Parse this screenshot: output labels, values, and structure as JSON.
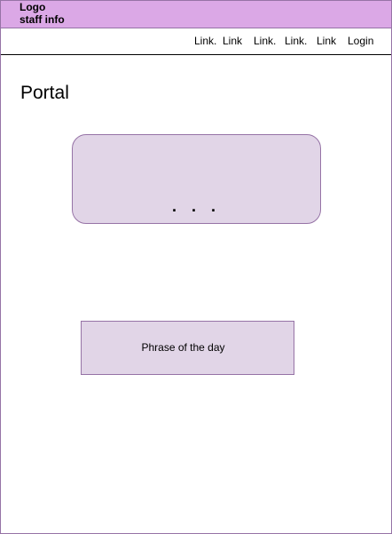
{
  "header": {
    "logo": "Logo",
    "staff_info": "staff info",
    "background_color": "#dba8e6"
  },
  "nav": {
    "links": [
      "Link.",
      "Link",
      "Link.",
      "Link.",
      "Link"
    ],
    "login": "Login"
  },
  "main": {
    "title": "Portal",
    "hero_card": {
      "content": ". . ."
    },
    "phrase_box": {
      "label": "Phrase of the day"
    }
  },
  "colors": {
    "card_fill": "#e1d5e7",
    "card_border": "#9673a6"
  }
}
